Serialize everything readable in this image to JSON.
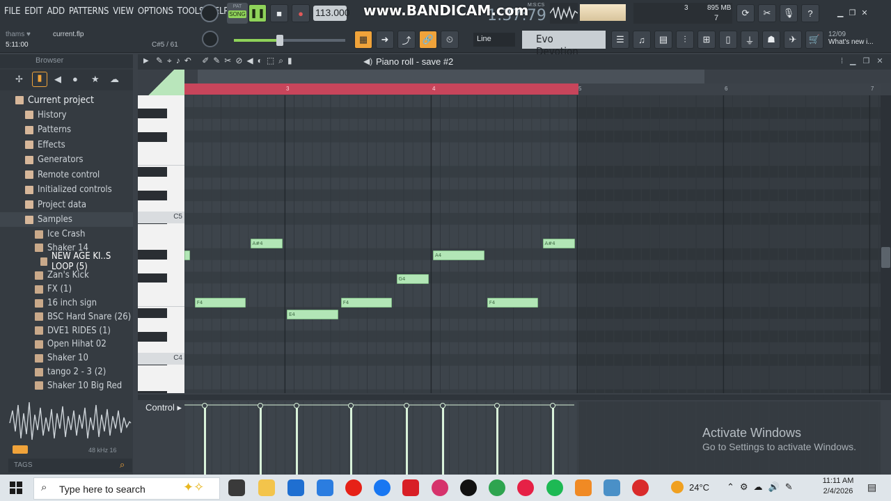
{
  "menu": [
    "FILE",
    "EDIT",
    "ADD",
    "PATTERNS",
    "VIEW",
    "OPTIONS",
    "TOOLS",
    "HELP"
  ],
  "transport": {
    "mode": "SONG",
    "mode_top": "PAT",
    "tempo": "113.000",
    "time": "1:37:79",
    "time_unit": "M:S:CS"
  },
  "recorder_watermark": "www.BANDICAM.com",
  "system_meter": {
    "cpu": "3",
    "memory": "895 MB",
    "polyphony": "7"
  },
  "hint": {
    "user": "thams",
    "file": "current.flp",
    "position": "5:11:00",
    "note": "C#5 / 61"
  },
  "toolbar2": {
    "snap": "Line",
    "preset": "Evo Devotion",
    "news_date": "12/09",
    "news_text": "What's new i..."
  },
  "browser": {
    "title": "Browser",
    "items": [
      {
        "label": "Current project",
        "type": "root"
      },
      {
        "label": "History",
        "type": "cat"
      },
      {
        "label": "Patterns",
        "type": "cat"
      },
      {
        "label": "Effects",
        "type": "cat"
      },
      {
        "label": "Generators",
        "type": "cat"
      },
      {
        "label": "Remote control",
        "type": "cat"
      },
      {
        "label": "Initialized controls",
        "type": "cat"
      },
      {
        "label": "Project data",
        "type": "cat"
      },
      {
        "label": "Samples",
        "type": "cat"
      },
      {
        "label": "Ice Crash",
        "type": "sample"
      },
      {
        "label": "Shaker 14",
        "type": "sample"
      },
      {
        "label": "NEW AGE KI..S LOOP (5)",
        "type": "sample"
      },
      {
        "label": "Zan's Kick",
        "type": "sample"
      },
      {
        "label": "FX (1)",
        "type": "sample"
      },
      {
        "label": "16 inch sign",
        "type": "sample"
      },
      {
        "label": "BSC Hard Snare  (26)",
        "type": "sample"
      },
      {
        "label": "DVE1 RIDES (1)",
        "type": "sample"
      },
      {
        "label": "Open Hihat 02",
        "type": "sample"
      },
      {
        "label": "Shaker 10",
        "type": "sample"
      },
      {
        "label": "tango 2 - 3 (2)",
        "type": "sample"
      },
      {
        "label": "Shaker 10 Big Red",
        "type": "sample"
      }
    ],
    "sample_rate": "48 kHz 16",
    "tags": "TAGS"
  },
  "piano_roll": {
    "title": "Piano roll - save #2",
    "bars": [
      "3",
      "4",
      "5",
      "6",
      "7"
    ],
    "key_labels": [
      "C5",
      "C4"
    ],
    "notes": [
      {
        "label": "",
        "start": 0.0,
        "len": 0.04
      },
      {
        "label": "F4",
        "start": 0.07,
        "len": 0.35
      },
      {
        "label": "A#4",
        "start": 0.45,
        "len": 0.22
      },
      {
        "label": "E4",
        "start": 0.7,
        "len": 0.35
      },
      {
        "label": "F4",
        "start": 1.07,
        "len": 0.35
      },
      {
        "label": "G4",
        "start": 1.45,
        "len": 0.22
      },
      {
        "label": "A4",
        "start": 1.7,
        "len": 0.35
      },
      {
        "label": "F4",
        "start": 2.07,
        "len": 0.35
      },
      {
        "label": "A#4",
        "start": 2.45,
        "len": 0.22
      }
    ],
    "control_label": "Control"
  },
  "watermark": {
    "line1": "Activate Windows",
    "line2": "Go to Settings to activate Windows."
  },
  "taskbar": {
    "search_placeholder": "Type here to search",
    "weather": "24°C",
    "time": "11:11 AM",
    "date": "2/4/2026"
  }
}
